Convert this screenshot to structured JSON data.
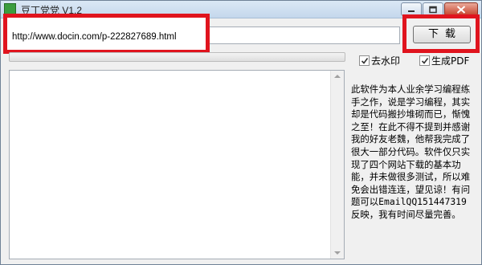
{
  "window": {
    "title": "豆丁党党  V1.2",
    "icon": "app-icon",
    "controls": [
      "minimize-icon",
      "maximize-icon",
      "close-icon"
    ]
  },
  "url_field": {
    "value": "http://www.docin.com/p-222827689.html"
  },
  "download_button": {
    "label": "下载"
  },
  "progress": {
    "fraction": 0.0
  },
  "options": [
    {
      "label": "去水印",
      "checked": true
    },
    {
      "label": "生成PDF",
      "checked": true
    }
  ],
  "log": {
    "content": ""
  },
  "about": {
    "text": "此软件为本人业余学习编程练手之作，说是学习编程，其实却是代码搬抄堆砌而已，惭愧之至！在此不得不提到并感谢我的好友老魏，他帮我完成了很大一部分代码。软件仅只实现了四个网站下载的基本功能，并未做很多测试，所以难免会出错连连，望见谅！有问题可以EmailQQ151447319反映，我有时间尽量完善。"
  },
  "colors": {
    "highlight": "#e0141e",
    "progress_fill": "#3cb33c",
    "title_bar": "#c4d7ec"
  }
}
